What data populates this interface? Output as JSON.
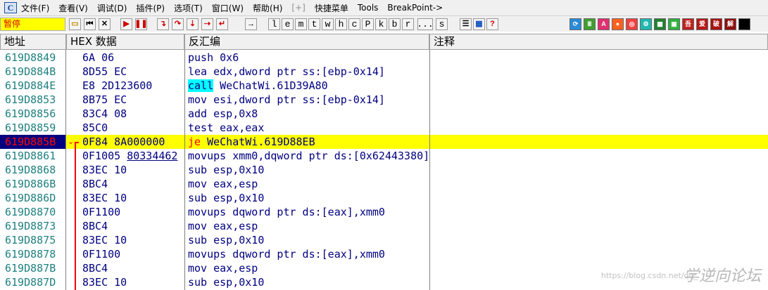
{
  "menu": {
    "app_icon": "C",
    "items": [
      "文件(F)",
      "查看(V)",
      "调试(D)",
      "插件(P)",
      "选项(T)",
      "窗口(W)",
      "帮助(H)",
      "[+]",
      "快捷菜单",
      "Tools",
      "BreakPoint->"
    ]
  },
  "toolbar": {
    "status": "暂停",
    "letter_buttons": [
      "l",
      "e",
      "m",
      "t",
      "w",
      "h",
      "c",
      "P",
      "k",
      "b",
      "r",
      "...",
      "s"
    ]
  },
  "columns": [
    "地址",
    "HEX 数据",
    "反汇编",
    "注释"
  ],
  "rows": [
    {
      "addr": "619D8849",
      "hex": "6A 06",
      "dis": "push 0x6"
    },
    {
      "addr": "619D884B",
      "hex": "8D55 EC",
      "dis": "lea edx,dword ptr ss:[ebp-0x14]"
    },
    {
      "addr": "619D884E",
      "hex": "E8 2D123600",
      "dis_hl": "call",
      "dis_rest": " WeChatWi.61D39A80"
    },
    {
      "addr": "619D8853",
      "hex": "8B75 EC",
      "dis": "mov esi,dword ptr ss:[ebp-0x14]"
    },
    {
      "addr": "619D8856",
      "hex": "83C4 08",
      "dis": "add esp,0x8"
    },
    {
      "addr": "619D8859",
      "hex": "85C0",
      "dis": "test eax,eax"
    },
    {
      "addr": "619D885B",
      "hex": "0F84 8A000000",
      "dis_red": "je",
      "dis_rest": " WeChatWi.619D88EB"
    },
    {
      "addr": "619D8861",
      "hex_a": "0F1005 ",
      "hex_link": "80334462",
      "dis": "movups xmm0,dqword ptr ds:[0x62443380]"
    },
    {
      "addr": "619D8868",
      "hex": "83EC 10",
      "dis": "sub esp,0x10"
    },
    {
      "addr": "619D886B",
      "hex": "8BC4",
      "dis": "mov eax,esp"
    },
    {
      "addr": "619D886D",
      "hex": "83EC 10",
      "dis": "sub esp,0x10"
    },
    {
      "addr": "619D8870",
      "hex": "0F1100",
      "dis": "movups dqword ptr ds:[eax],xmm0"
    },
    {
      "addr": "619D8873",
      "hex": "8BC4",
      "dis": "mov eax,esp"
    },
    {
      "addr": "619D8875",
      "hex": "83EC 10",
      "dis": "sub esp,0x10"
    },
    {
      "addr": "619D8878",
      "hex": "0F1100",
      "dis": "movups dqword ptr ds:[eax],xmm0"
    },
    {
      "addr": "619D887B",
      "hex": "8BC4",
      "dis": "mov eax,esp"
    },
    {
      "addr": "619D887D",
      "hex": "83EC 10",
      "dis": "sub esp,0x10"
    }
  ],
  "watermark": {
    "url": "https://blog.csdn.net/qq_",
    "logo": "学逆向论坛"
  }
}
